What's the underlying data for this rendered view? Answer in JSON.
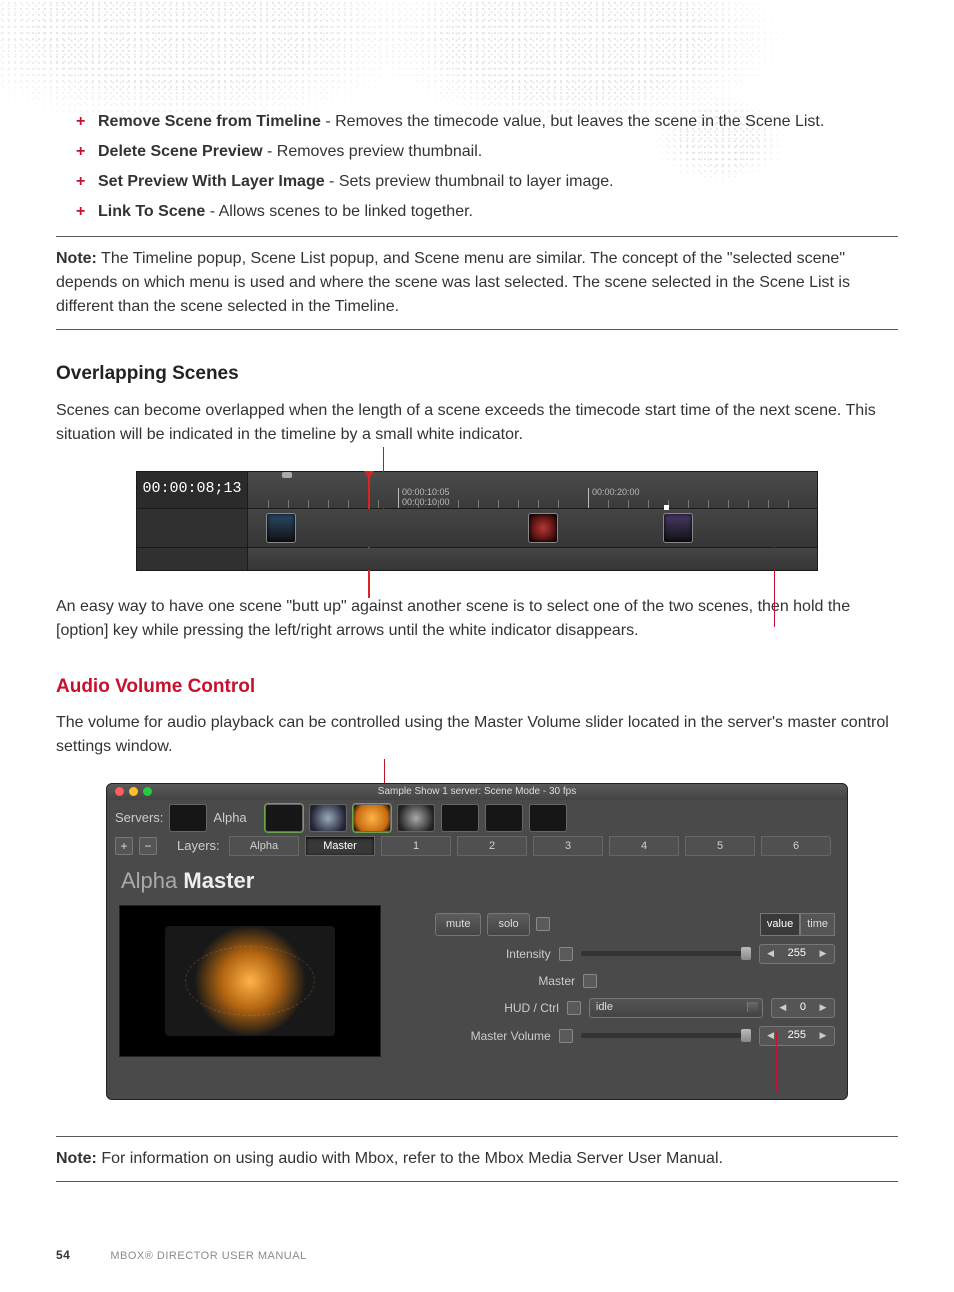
{
  "bullets": [
    {
      "term": "Remove Scene from Timeline",
      "desc": " - Removes the timecode value, but leaves the scene in the Scene List."
    },
    {
      "term": "Delete Scene Preview",
      "desc": " - Removes preview thumbnail."
    },
    {
      "term": "Set Preview With Layer Image",
      "desc": " - Sets preview thumbnail to layer image."
    },
    {
      "term": "Link To Scene",
      "desc": " - Allows scenes to be linked together."
    }
  ],
  "note1": {
    "label": "Note:",
    "body": "  The Timeline popup, Scene List popup, and Scene menu are similar. The concept of the \"selected scene\" depends on which menu is used and where the scene was last selected. The scene selected in the Scene List is different than the scene selected in the Timeline."
  },
  "overlap": {
    "heading": "Overlapping Scenes",
    "p1": "Scenes can become overlapped when the length of a scene exceeds the timecode start time of the next scene. This situation will be indicated in the timeline by a small white indicator.",
    "p2": "An easy way to have one scene \"butt up\" against another scene is to select one of the two scenes, then hold the [option] key while pressing the left/right arrows until the white indicator disappears."
  },
  "timeline": {
    "current": "00:00:08;13",
    "label1": "00:00:10:05",
    "label1b": "00:00:10:00",
    "label2": "00:00:20:00"
  },
  "audio": {
    "heading": "Audio Volume Control",
    "p": "The volume for audio playback can be controlled using the Master Volume slider located in the server's master control settings window."
  },
  "masterwin": {
    "title": "Sample Show 1 server: Scene Mode - 30 fps",
    "servers_label": "Servers:",
    "layers_label": "Layers:",
    "alpha": "Alpha",
    "tabs": [
      "Alpha",
      "Master",
      "1",
      "2",
      "3",
      "4",
      "5",
      "6"
    ],
    "panel_title_a": "Alpha ",
    "panel_title_b": "Master",
    "mute": "mute",
    "solo": "solo",
    "value": "value",
    "time": "time",
    "intensity": "Intensity",
    "master": "Master",
    "hud": "HUD / Ctrl",
    "hud_select": "idle",
    "mvol": "Master Volume",
    "spin1": "255",
    "spin2": "0",
    "spin3": "255"
  },
  "note2": {
    "label": "Note:",
    "body": "  For information on using audio with Mbox, refer to the Mbox Media Server User Manual."
  },
  "footer": {
    "page": "54",
    "doc": "MBOX® DIRECTOR USER MANUAL"
  }
}
